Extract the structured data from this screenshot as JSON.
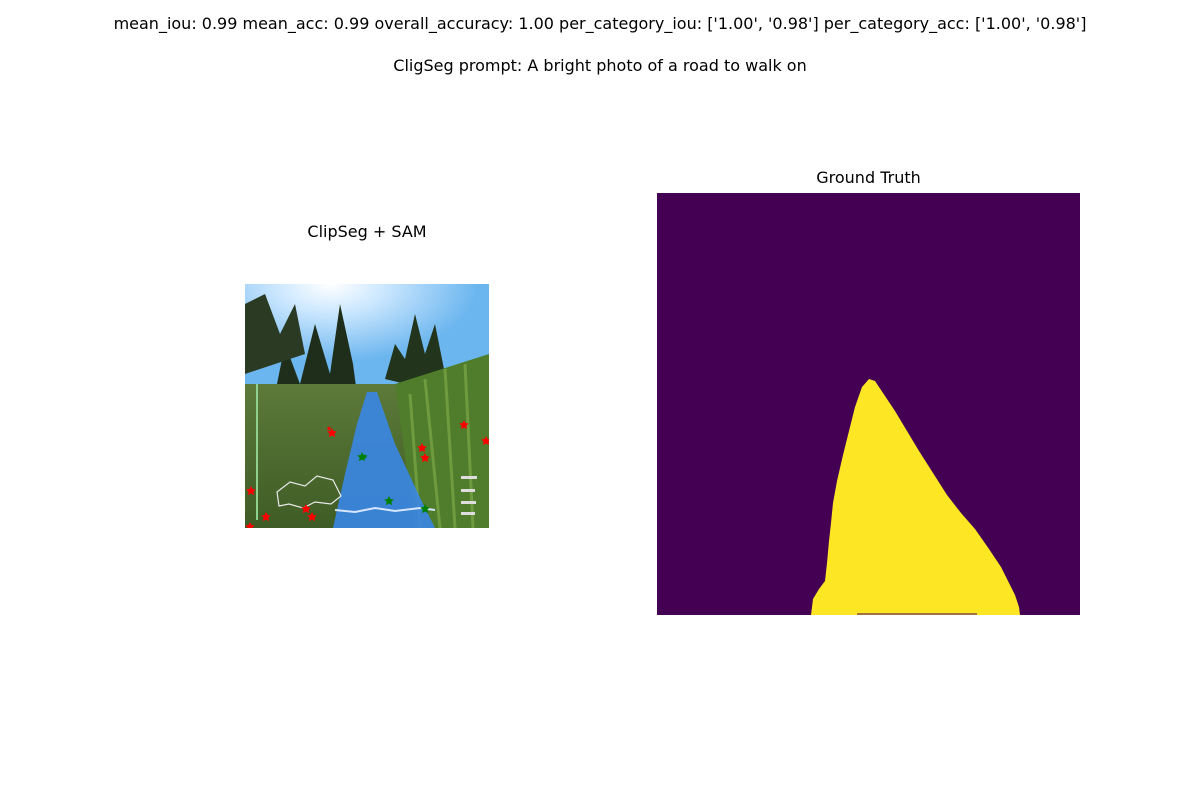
{
  "header": {
    "metrics": "mean_iou: 0.99  mean_acc: 0.99  overall_accuracy: 1.00  per_category_iou: ['1.00', '0.98']  per_category_acc: ['1.00', '0.98']",
    "prompt": "CligSeg prompt: A bright photo of a road to walk on"
  },
  "panels": {
    "left": {
      "title": "ClipSeg + SAM",
      "overlay_color": "#3a86e6",
      "positive_point_color": "#008000",
      "negative_point_color": "#ff0000",
      "positive_points": 4,
      "negative_points": 11
    },
    "right": {
      "title": "Ground Truth",
      "background_color": "#440154",
      "mask_color": "#fde725"
    }
  }
}
